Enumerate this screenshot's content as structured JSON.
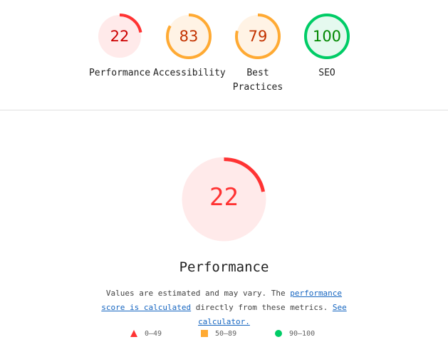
{
  "categories": [
    {
      "label": "Performance",
      "score": 22,
      "status": "fail"
    },
    {
      "label": "Accessibility",
      "score": 83,
      "status": "average"
    },
    {
      "label": "Best Practices",
      "label_line1": "Best",
      "label_line2": "Practices",
      "score": 79,
      "status": "average"
    },
    {
      "label": "SEO",
      "score": 100,
      "status": "pass"
    }
  ],
  "colors": {
    "fail": {
      "stroke": "#ff3333",
      "fill": "#ffeaea",
      "text": "#cc0000"
    },
    "fail_big_text": "#ff3333",
    "average": {
      "stroke": "#ffaa33",
      "fill": "#fff3e5",
      "text": "#c33300"
    },
    "pass": {
      "stroke": "#00cc66",
      "fill": "#e5f9ef",
      "text": "#008800"
    },
    "link": "#1565c0"
  },
  "detail": {
    "score": 22,
    "title": "Performance",
    "desc_text_1": "Values are estimated and may vary. The ",
    "desc_link_1": "performance score is calculated",
    "desc_text_2": " directly from these metrics. ",
    "desc_link_2": "See calculator."
  },
  "legend": [
    {
      "shape": "triangle-icon",
      "range": "0–49"
    },
    {
      "shape": "square-icon",
      "range": "50–89"
    },
    {
      "shape": "circle-icon",
      "range": "90–100"
    }
  ]
}
